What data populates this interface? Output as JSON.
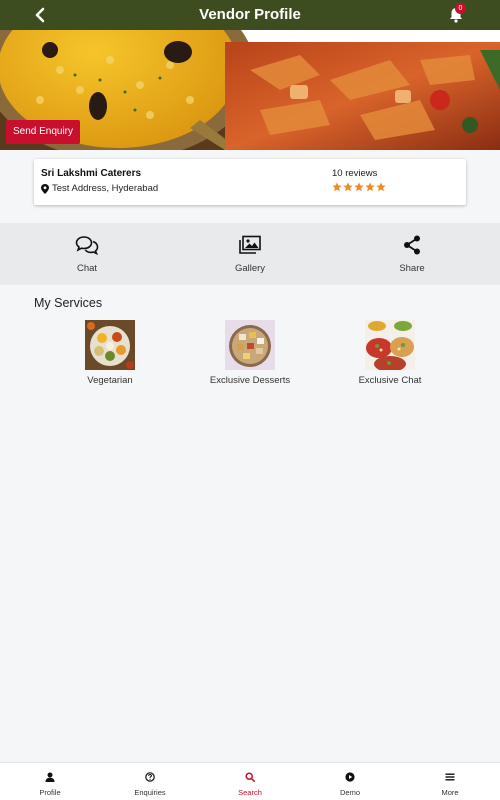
{
  "header": {
    "title": "Vendor Profile",
    "notification_count": "0"
  },
  "hero": {
    "enquiry_label": "Send Enquiry"
  },
  "vendor": {
    "name": "Sri Lakshmi Caterers",
    "address": "Test Address, Hyderabad",
    "reviews": "10 reviews",
    "rating": 5,
    "star_color": "#f08a24"
  },
  "actions": [
    {
      "label": "Chat",
      "icon": "chat-icon"
    },
    {
      "label": "Gallery",
      "icon": "gallery-icon"
    },
    {
      "label": "Share",
      "icon": "share-icon"
    }
  ],
  "services": {
    "title": "My Services",
    "items": [
      {
        "label": "Vegetarian"
      },
      {
        "label": "Exclusive Desserts"
      },
      {
        "label": "Exclusive Chat"
      }
    ]
  },
  "bottom_nav": {
    "active": "Search",
    "items": [
      {
        "label": "Profile",
        "icon": "user-icon"
      },
      {
        "label": "Enquiries",
        "icon": "question-circle-icon"
      },
      {
        "label": "Search",
        "icon": "search-icon"
      },
      {
        "label": "Demo",
        "icon": "play-circle-icon"
      },
      {
        "label": "More",
        "icon": "menu-icon"
      }
    ]
  },
  "colors": {
    "header": "#3e4d1f",
    "accent": "#c8102e",
    "star": "#f08a24"
  }
}
